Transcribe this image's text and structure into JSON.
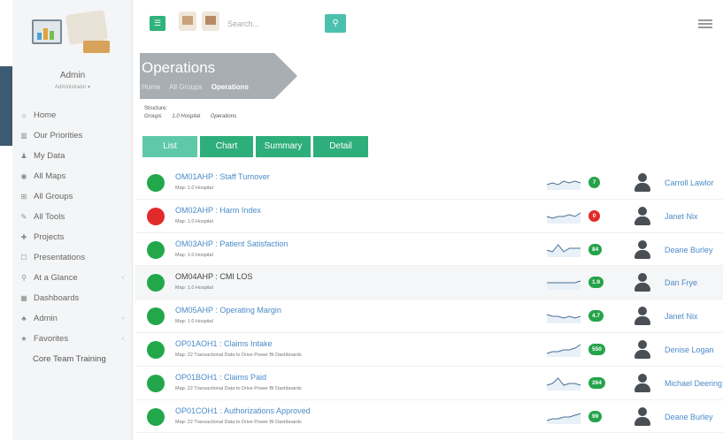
{
  "sidebar": {
    "user_name": "Admin",
    "user_role": "Administrator ▾",
    "items": [
      {
        "label": "Home",
        "icon": "home-icon",
        "glyph": "⌂",
        "chevron": false
      },
      {
        "label": "Our Priorities",
        "icon": "bar-chart-icon",
        "glyph": "▥",
        "chevron": false
      },
      {
        "label": "My Data",
        "icon": "user-icon",
        "glyph": "♟",
        "chevron": false
      },
      {
        "label": "All Maps",
        "icon": "map-marker-icon",
        "glyph": "◉",
        "chevron": false
      },
      {
        "label": "All Groups",
        "icon": "sitemap-icon",
        "glyph": "⊞",
        "chevron": false
      },
      {
        "label": "All Tools",
        "icon": "wrench-icon",
        "glyph": "✎",
        "chevron": false
      },
      {
        "label": "Projects",
        "icon": "plus-icon",
        "glyph": "✚",
        "chevron": false
      },
      {
        "label": "Presentations",
        "icon": "edit-icon",
        "glyph": "☐",
        "chevron": false
      },
      {
        "label": "At a Glance",
        "icon": "search-icon",
        "glyph": "⚲",
        "chevron": true
      },
      {
        "label": "Dashboards",
        "icon": "dashboard-icon",
        "glyph": "▦",
        "chevron": false
      },
      {
        "label": "Admin",
        "icon": "users-icon",
        "glyph": "♣",
        "chevron": true
      },
      {
        "label": "Favorites",
        "icon": "star-icon",
        "glyph": "★",
        "chevron": true
      }
    ],
    "sub_item": "Core Team Training"
  },
  "topbar": {
    "menu_icon": "menu-icon",
    "search_placeholder": "Search...",
    "search_icon": "search-icon",
    "toggle_icon": "toggle-panel-icon"
  },
  "header": {
    "title": "Operations",
    "breadcrumbs": [
      "Home",
      "All Groups",
      "Operations"
    ]
  },
  "structure": {
    "label": "Structure:",
    "path": [
      "Groups",
      "1.0 Hospital",
      "Operations"
    ]
  },
  "tabs": [
    "List",
    "Chart",
    "Summary",
    "Detail"
  ],
  "colors": {
    "green": "#22a84a",
    "red": "#e32a2a",
    "tab_active": "#5ec9a8",
    "tab": "#2eae7a",
    "link": "#4a8bc9",
    "badge_green": "#25a34a",
    "badge_red": "#e32a2a"
  },
  "rows": [
    {
      "title": "OM01AHP : Staff Turnover",
      "map": "Map: 1.0 Hospital",
      "status": "green",
      "badge": "7",
      "badge_color": "green",
      "owner": "Carroll Lawlor",
      "spark": [
        6,
        5,
        6,
        4,
        5,
        4,
        5
      ]
    },
    {
      "title": "OM02AHP : Harm Index",
      "map": "Map: 1.0 Hospital",
      "status": "red",
      "badge": "0",
      "badge_color": "red",
      "owner": "Janet Nix",
      "spark": [
        5,
        6,
        5,
        5,
        4,
        5,
        3
      ]
    },
    {
      "title": "OM03AHP : Patient Satisfaction",
      "map": "Map: 1.0 Hospital",
      "status": "green",
      "badge": "84",
      "badge_color": "green",
      "owner": "Deane Burley",
      "spark": [
        5,
        6,
        2,
        6,
        4,
        4,
        4
      ]
    },
    {
      "title": "OM04AHP : CMI LOS",
      "map": "Map: 1.0 Hospital",
      "status": "green",
      "badge": "1.9",
      "badge_color": "green",
      "owner": "Dan Frye",
      "spark": [
        5,
        5,
        5,
        5,
        5,
        5,
        4
      ]
    },
    {
      "title": "OM05AHP : Operating Margin",
      "map": "Map: 1.0 Hospital",
      "status": "green",
      "badge": "4.7",
      "badge_color": "green",
      "owner": "Janet Nix",
      "spark": [
        4,
        5,
        5,
        6,
        5,
        6,
        5
      ]
    },
    {
      "title": "OP01AOH1 : Claims Intake",
      "map": "Map: 22 Transactional Data to Drive Power BI Dashboards",
      "status": "green",
      "badge": "550",
      "badge_color": "green",
      "owner": "Denise Logan",
      "spark": [
        7,
        6,
        6,
        5,
        5,
        4,
        2
      ]
    },
    {
      "title": "OP01BOH1 : Claims Paid",
      "map": "Map: 22 Transactional Data to Drive Power BI Dashboards",
      "status": "green",
      "badge": "264",
      "badge_color": "green",
      "owner": "Michael Deering",
      "spark": [
        6,
        5,
        2,
        6,
        5,
        5,
        6
      ]
    },
    {
      "title": "OP01COH1 : Authorizations Approved",
      "map": "Map: 22 Transactional Data to Drive Power BI Dashboards",
      "status": "green",
      "badge": "99",
      "badge_color": "green",
      "owner": "Deane Burley",
      "spark": [
        7,
        6,
        6,
        5,
        5,
        4,
        3
      ]
    }
  ]
}
